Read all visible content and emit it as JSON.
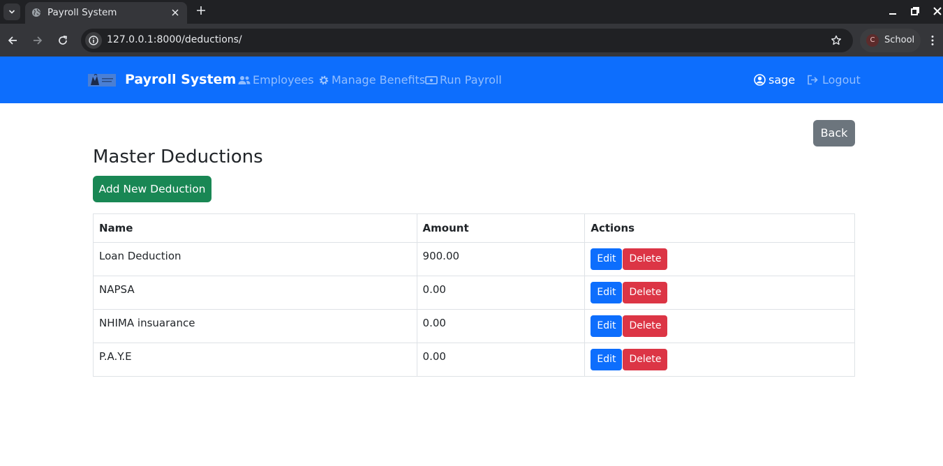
{
  "browser": {
    "tab_title": "Payroll System",
    "url": "127.0.0.1:8000/deductions/",
    "profile_initial": "C",
    "profile_name": "School"
  },
  "navbar": {
    "brand": "Payroll System",
    "links": [
      {
        "label": "Employees",
        "icon": "users-icon"
      },
      {
        "label": "Manage Benefits",
        "icon": "gear-icon"
      },
      {
        "label": "Run Payroll",
        "icon": "money-bill-icon"
      }
    ],
    "user": "sage",
    "logout": "Logout"
  },
  "page": {
    "back_label": "Back",
    "title": "Master Deductions",
    "add_label": "Add New Deduction"
  },
  "table": {
    "headers": [
      "Name",
      "Amount",
      "Actions"
    ],
    "rows": [
      {
        "name": "Loan Deduction",
        "amount": "900.00"
      },
      {
        "name": "NAPSA",
        "amount": "0.00"
      },
      {
        "name": "NHIMA insuarance",
        "amount": "0.00"
      },
      {
        "name": "P.A.Y.E",
        "amount": "0.00"
      }
    ],
    "edit_label": "Edit",
    "delete_label": "Delete"
  },
  "colors": {
    "navbar": "#0d6efd",
    "back_button": "#6c757d",
    "add_button": "#198754",
    "edit_button": "#0d6efd",
    "delete_button": "#dc3545"
  }
}
